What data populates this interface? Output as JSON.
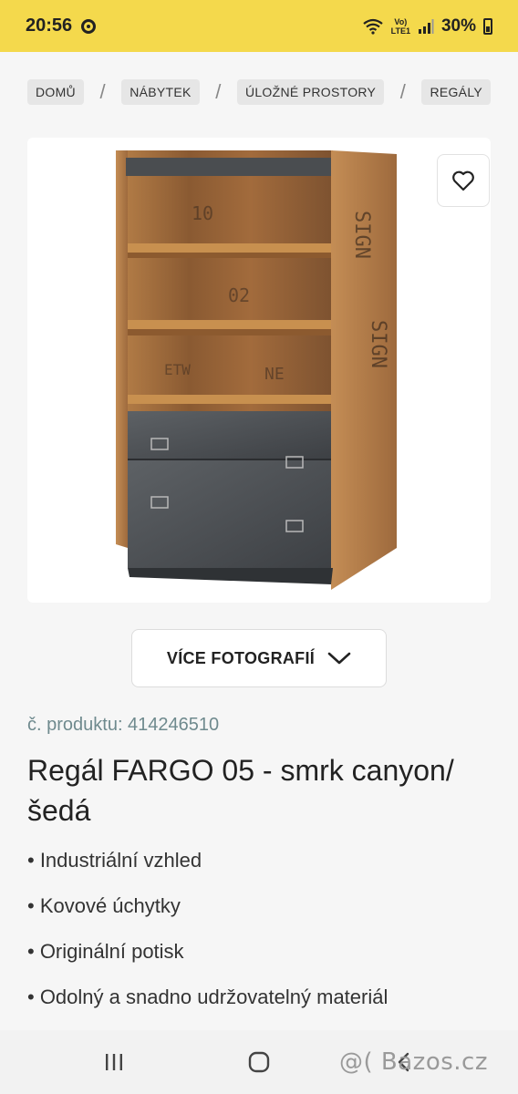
{
  "status_bar": {
    "time": "20:56",
    "network_top": "Vo)",
    "network_bottom": "LTE1",
    "battery": "30%"
  },
  "breadcrumb": {
    "items": [
      "DOMŮ",
      "NÁBYTEK",
      "ÚLOŽNÉ PROSTORY",
      "REGÁLY"
    ],
    "separator": "/"
  },
  "gallery": {
    "more_label": "VÍCE FOTOGRAFIÍ",
    "favorite_icon": "heart-icon",
    "expand_icon": "chevron-down-icon"
  },
  "product": {
    "number_label": "č. produktu: 414246510",
    "title": "Regál FARGO 05 - smrk canyon/šedá",
    "features": [
      "• Industriální vzhled",
      "• Kovové úchytky",
      "• Originální potisk",
      "• Odolný a snadno udržovatelný materiál"
    ]
  },
  "navigation": {
    "recent_icon": "recent-apps-icon",
    "home_icon": "home-icon",
    "back_icon": "back-icon"
  },
  "watermark": "@( Bazos.cz",
  "colors": {
    "status_bar": "#f4d94c",
    "product_number": "#6f8a8e",
    "background": "#f6f6f6"
  }
}
